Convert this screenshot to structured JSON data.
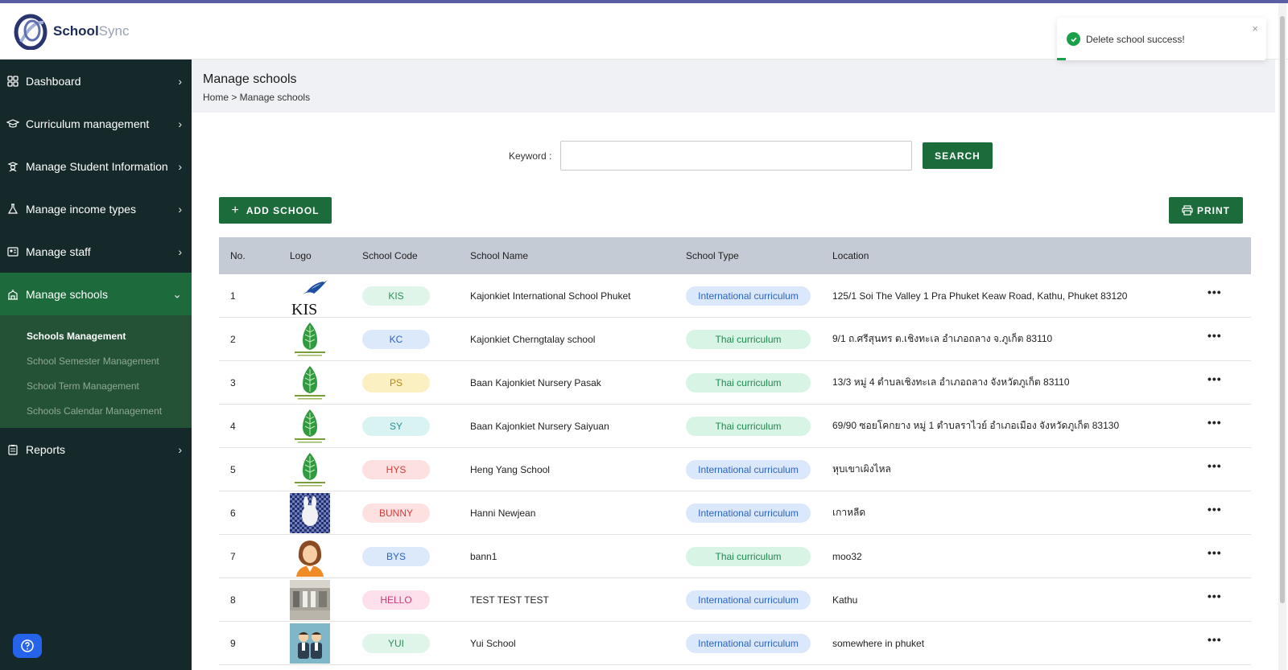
{
  "app": {
    "logo_primary": "School",
    "logo_secondary": "Sync"
  },
  "sidebar": {
    "items": [
      {
        "label": "Dashboard",
        "icon": "dashboard-grid-icon"
      },
      {
        "label": "Curriculum management",
        "icon": "graduation-cap-icon"
      },
      {
        "label": "Manage Student Information",
        "icon": "student-icon"
      },
      {
        "label": "Manage income types",
        "icon": "flask-icon"
      },
      {
        "label": "Manage staff",
        "icon": "id-card-icon"
      },
      {
        "label": "Manage schools",
        "icon": "school-building-icon"
      },
      {
        "label": "Reports",
        "icon": "clipboard-icon"
      }
    ],
    "submenu": [
      "Schools Management",
      "School Semester Management",
      "School Term Management",
      "Schools Calendar Management"
    ]
  },
  "page": {
    "title": "Manage schools",
    "breadcrumb": "Home > Manage schools"
  },
  "search": {
    "label": "Keyword :",
    "value": "",
    "button": "SEARCH"
  },
  "actions": {
    "add_label": "ADD SCHOOL",
    "print_label": "PRINT"
  },
  "table": {
    "headers": {
      "no": "No.",
      "logo": "Logo",
      "code": "School Code",
      "name": "School Name",
      "type": "School Type",
      "location": "Location"
    },
    "rows": [
      {
        "no": "1",
        "code": "KIS",
        "name": "Kajonkiet International School Phuket",
        "type": "International curriculum",
        "location": "125/1 Soi The Valley 1 Pra Phuket Keaw Road, Kathu, Phuket 83120",
        "logo": "kis"
      },
      {
        "no": "2",
        "code": "KC",
        "name": "Kajonkiet Cherngtalay school",
        "type": "Thai curriculum",
        "location": "9/1 ถ.ศรีสุนทร ต.เชิงทะเล อำเภอถลาง จ.ภูเก็ต 83110",
        "logo": "leaf"
      },
      {
        "no": "3",
        "code": "PS",
        "name": "Baan Kajonkiet Nursery Pasak",
        "type": "Thai curriculum",
        "location": "13/3 หมู่ 4 ตำบลเชิงทะเล อำเภอถลาง จังหวัดภูเก็ต 83110",
        "logo": "leaf"
      },
      {
        "no": "4",
        "code": "SY",
        "name": "Baan Kajonkiet Nursery Saiyuan",
        "type": "Thai curriculum",
        "location": "69/90 ซอยโคกยาง หมู่ 1 ตำบลราไวย์ อำเภอเมือง จังหวัดภูเก็ต 83130",
        "logo": "leaf"
      },
      {
        "no": "5",
        "code": "HYS",
        "name": "Heng Yang School",
        "type": "International curriculum",
        "location": "หุบเขาเผิงไหล",
        "logo": "leaf"
      },
      {
        "no": "6",
        "code": "BUNNY",
        "name": "Hanni Newjean",
        "type": "International curriculum",
        "location": "เกาหลีด",
        "logo": "bunny"
      },
      {
        "no": "7",
        "code": "BYS",
        "name": "bann1",
        "type": "Thai curriculum",
        "location": "moo32",
        "logo": "woman"
      },
      {
        "no": "8",
        "code": "HELLO",
        "name": "TEST TEST TEST",
        "type": "International curriculum",
        "location": "Kathu",
        "logo": "building"
      },
      {
        "no": "9",
        "code": "YUI",
        "name": "Yui School",
        "type": "International curriculum",
        "location": "somewhere in phuket",
        "logo": "people"
      }
    ],
    "more_label": "•••"
  },
  "toast": {
    "message": "Delete school success!",
    "close": "×"
  },
  "colors": {
    "sidebar_bg": "#16292a",
    "active_green": "#1d6a3d",
    "button_green": "#1c6b3b",
    "badge": {
      "KIS": [
        "#dff5ea",
        "#2f8f5a"
      ],
      "KC": [
        "#dce9fb",
        "#2c63c7"
      ],
      "PS": [
        "#fbf0c2",
        "#b7861a"
      ],
      "SY": [
        "#d9f3f3",
        "#2a8f8f"
      ],
      "HYS": [
        "#fde1e1",
        "#d23b3b"
      ],
      "BUNNY": [
        "#fde1e1",
        "#d23b3b"
      ],
      "BYS": [
        "#dce9fb",
        "#2c63c7"
      ],
      "HELLO": [
        "#fde0ec",
        "#cf3a78"
      ],
      "YUI": [
        "#dff5ea",
        "#2f8f5a"
      ]
    },
    "type": {
      "International curriculum": [
        "#dbe8fb",
        "#2c63c7"
      ],
      "Thai curriculum": [
        "#d8f4e4",
        "#1f8a4f"
      ]
    }
  }
}
